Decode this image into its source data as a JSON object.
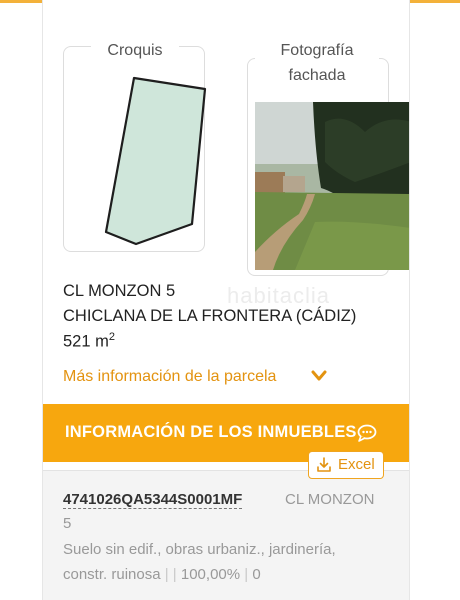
{
  "colors": {
    "accent": "#f7a70e",
    "link": "#e39310",
    "text": "#222222",
    "muted": "#999999",
    "parcel_fill": "#cfe6da"
  },
  "croquis": {
    "label": "Croquis"
  },
  "photo": {
    "label_line1": "Fotografía",
    "label_line2": "fachada"
  },
  "watermark": "habitaclia",
  "address": {
    "street": "CL MONZON 5",
    "city": "CHICLANA DE LA FRONTERA (CÁDIZ)",
    "area_value": "521 m",
    "area_exp": "2"
  },
  "more_info": {
    "label": "Más información de la parcela",
    "icon": "chevron-down-icon"
  },
  "properties": {
    "title": "INFORMACIÓN DE LOS INMUEBLES",
    "icon": "chat-bubble-icon",
    "excel": {
      "label": "Excel",
      "icon": "download-icon"
    },
    "item": {
      "reference": "4741026QA5344S0001MF",
      "street": "CL MONZON",
      "number": "5",
      "use_line1": "Suelo sin edif., obras urbaniz., jardinería,",
      "use_line2_text": "constr. ruinosa",
      "separator": "| |",
      "percentage": "100,00%",
      "separator2": "|",
      "value": "0"
    }
  }
}
